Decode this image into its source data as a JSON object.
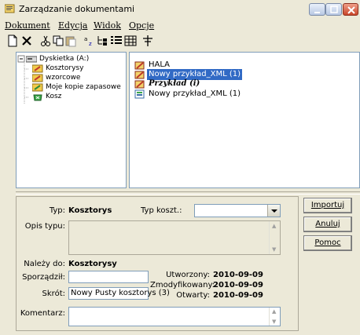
{
  "window": {
    "title": "Zarządzanie dokumentami"
  },
  "menu": [
    {
      "label": "Dokument",
      "mnemonic": "D"
    },
    {
      "label": "Edycja",
      "mnemonic": "E"
    },
    {
      "label": "Widok",
      "mnemonic": "W"
    },
    {
      "label": "Opcje",
      "mnemonic": "O"
    }
  ],
  "toolbar": {
    "icons": [
      "new-document-icon",
      "delete-icon",
      "cut-icon",
      "copy-icon",
      "paste-icon",
      "sort-icon",
      "tree-view-icon",
      "details-view-icon",
      "icons-view-icon",
      "options-icon"
    ]
  },
  "tree": {
    "items": [
      {
        "label": "Dyskietka (A:)",
        "icon": "floppy-drive-icon",
        "level": 0
      },
      {
        "label": "Kosztorysy",
        "icon": "folder-icon",
        "level": 1
      },
      {
        "label": "wzorcowe",
        "icon": "folder-icon",
        "level": 1
      },
      {
        "label": "Moje kopie zapasowe",
        "icon": "folder-icon",
        "level": 1
      },
      {
        "label": "Kosz",
        "icon": "recycle-bin-icon",
        "level": 1
      }
    ]
  },
  "files": {
    "items": [
      {
        "label": "HALA",
        "icon": "document-icon",
        "style": "normal"
      },
      {
        "label": "Nowy przykład_XML (1)",
        "icon": "document-icon",
        "style": "selected"
      },
      {
        "label": "Przykład (i)",
        "icon": "document-icon",
        "style": "bolditalic"
      },
      {
        "label": "Nowy przykład_XML (1)",
        "icon": "xml-document-icon",
        "style": "normal"
      }
    ]
  },
  "details": {
    "typ_label": "Typ:",
    "typ_value": "Kosztorys",
    "typ_koszt_label": "Typ koszt.:",
    "typ_koszt_value": "",
    "opis_typu_label": "Opis typu:",
    "nalezy_do_label": "Należy do:",
    "nalezy_do_value": "Kosztorysy",
    "sporzadzil_label": "Sporządził:",
    "sporzadzil_value": "",
    "skrot_label": "Skrót:",
    "skrot_value": "Nowy Pusty kosztorys (3)",
    "komentarz_label": "Komentarz:",
    "utworzony_label": "Utworzony:",
    "utworzony_value": "2010-09-09",
    "zmodyfikowany_label": "Zmodyfikowany:",
    "zmodyfikowany_value": "2010-09-09",
    "otwarty_label": "Otwarty:",
    "otwarty_value": "2010-09-09"
  },
  "buttons": {
    "importuj": "Importuj",
    "anuluj": "Anuluj",
    "pomoc": "Pomoc"
  }
}
